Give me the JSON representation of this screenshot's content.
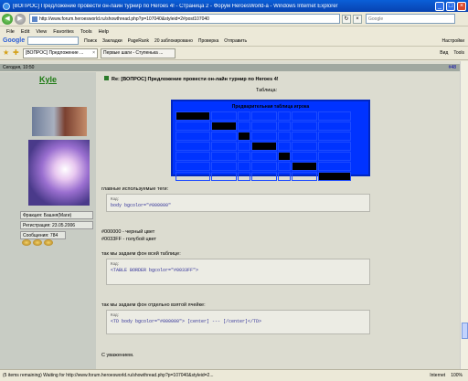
{
  "browser": {
    "title": "[ВОПРОС] Предложение провести он-лайн турнир по Heroes 4! - Страница 2 - Форум HeroesWorld-a - Windows Internet Explorer",
    "url": "http://www.forum.heroesworld.ru/showthread.php?p=107040&styleid=2#post107040",
    "search_placeholder": "Google",
    "menu": [
      "File",
      "Edit",
      "View",
      "Favorites",
      "Tools",
      "Help"
    ],
    "google_bar": {
      "logo": "Google",
      "search_label": "Поиск",
      "bookmarks": "Закладки",
      "pagerank": "PageRank",
      "blocked": "20 заблокировано",
      "check": "Проверка",
      "send": "Отправить",
      "settings": "Настройки"
    },
    "tabs": [
      {
        "label": "[ВОПРОС] Предложение ..."
      },
      {
        "label": "Первые шаги - Ступенька ..."
      }
    ],
    "tab_tools": {
      "page": "Вид",
      "tools": "Tools"
    },
    "status": {
      "text": "(5 items remaining) Waiting for http://www.forum.heroesworld.ru/showthread.php?p=107040&styleid=2...",
      "zone": "Internet",
      "zoom": "100%"
    }
  },
  "post": {
    "date": "Сегодня, 10:50",
    "post_number": "#48",
    "username": "Kyle",
    "faction": "Фракция: Башня(Маги)",
    "registered": "Регистрация: 23.05.2006",
    "messages": "Сообщения: 784",
    "title": "Re: [ВОПРОС] Предложение провести он-лайн турнир по Heroes 4!",
    "table_label": "Таблица:",
    "table_header": "Предварительная таблица игрока",
    "main_tags": "главные используемые теги:",
    "code_label": "Код:",
    "code1": "body bgcolor=\"#000000\"",
    "color1": "#000000 - черный цвет",
    "color2": "#0033FF - голубой цвет",
    "whole_table": "так мы задаем фон всей таблице:",
    "code2": "<TABLE BORDER bgcolor=\"#0033FF\">",
    "single_cell": "так мы задаем фон отдельно взятой ячейке:",
    "code3": "<TD body bgcolor=\"#000000\"> [center] --- [/center]</TD>",
    "regards": "С уважением."
  },
  "colors": {
    "table_bg": "#0033FF",
    "cell_black": "#000000",
    "username": "#1d7a12"
  }
}
